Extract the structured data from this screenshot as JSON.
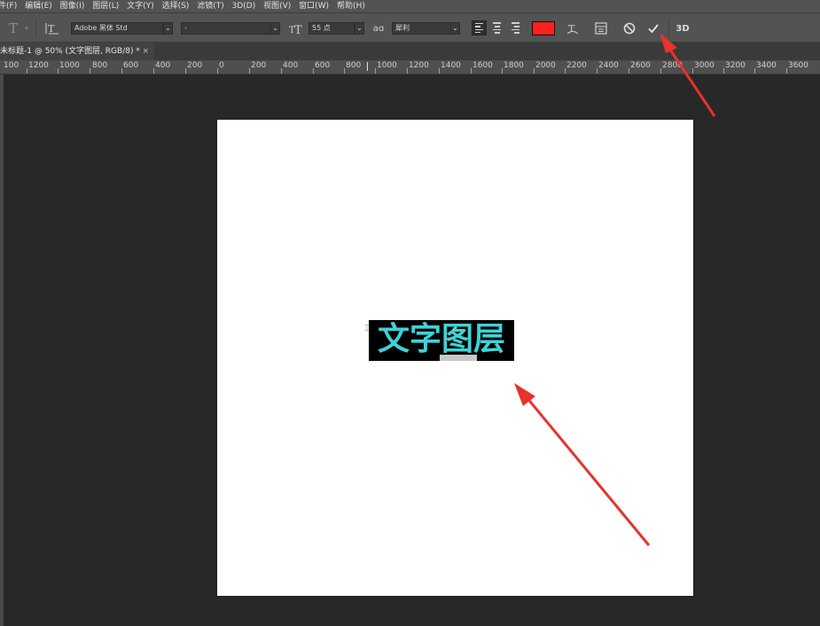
{
  "menubar": {
    "items": [
      "件(F)",
      "编辑(E)",
      "图像(I)",
      "图层(L)",
      "文字(Y)",
      "选择(S)",
      "滤镜(T)",
      "3D(D)",
      "视图(V)",
      "窗口(W)",
      "帮助(H)"
    ]
  },
  "options": {
    "font_family": "Adobe 黑体 Std",
    "font_style": "-",
    "font_size": "55 点",
    "aa_label": "aɑ",
    "anti_alias": "犀利",
    "text_color": "#ff2020",
    "btn_3d": "3D",
    "commit_icon": "check-icon",
    "cancel_icon": "cancel-icon"
  },
  "document": {
    "tab_title": "未标题-1 @ 50% (文字图层, RGB/8) *",
    "close": "×"
  },
  "ruler": {
    "labels": [
      "100",
      "1200",
      "1000",
      "800",
      "600",
      "400",
      "200",
      "0",
      "200",
      "400",
      "600",
      "800",
      "1000",
      "1200",
      "1400",
      "1600",
      "1800",
      "2000",
      "2200",
      "2400",
      "2600",
      "2800",
      "3000",
      "3200",
      "3400",
      "3600"
    ]
  },
  "canvas": {
    "text_layer": "文字图层",
    "text_color": "#3ed3d6"
  },
  "annotations": {
    "arrow_color": "#e8322e"
  }
}
